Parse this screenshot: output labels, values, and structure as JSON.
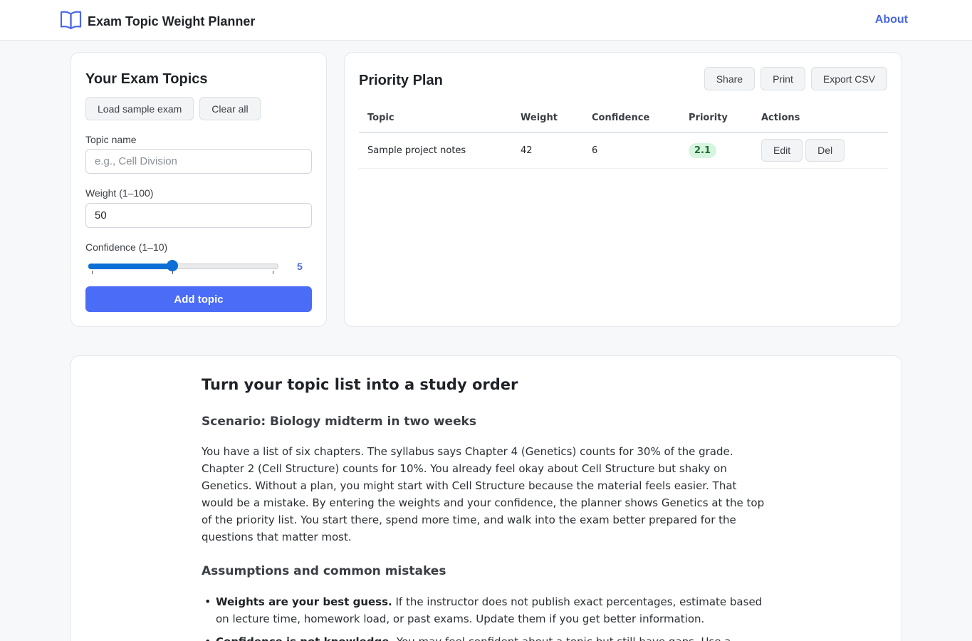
{
  "header": {
    "title": "Exam Topic Weight Planner",
    "about_label": "About",
    "logo_icon": "open-book-icon",
    "accent_color": "#4a67e6"
  },
  "topics_panel": {
    "title": "Your Exam Topics",
    "load_sample_label": "Load sample exam",
    "clear_all_label": "Clear all",
    "topic_name_label": "Topic name",
    "topic_name_placeholder": "e.g., Cell Division",
    "topic_name_value": "",
    "weight_label": "Weight (1–100)",
    "weight_value": "50",
    "confidence_label": "Confidence (1–10)",
    "confidence_value": "5",
    "confidence_min": 1,
    "confidence_max": 10,
    "add_topic_label": "Add topic"
  },
  "plan_panel": {
    "title": "Priority Plan",
    "share_label": "Share",
    "print_label": "Print",
    "export_label": "Export CSV",
    "columns": [
      "Topic",
      "Weight",
      "Confidence",
      "Priority",
      "Actions"
    ],
    "rows": [
      {
        "topic": "Sample project notes",
        "weight": "42",
        "confidence": "6",
        "priority": "2.1",
        "edit_label": "Edit",
        "delete_label": "Del"
      }
    ],
    "priority_badge_color": "#d6f5de"
  },
  "article": {
    "title": "Turn your topic list into a study order",
    "scenario_heading": "Scenario: Biology midterm in two weeks",
    "scenario_text": "You have a list of six chapters. The syllabus says Chapter 4 (Genetics) counts for 30% of the grade. Chapter 2 (Cell Structure) counts for 10%. You already feel okay about Cell Structure but shaky on Genetics. Without a plan, you might start with Cell Structure because the material feels easier. That would be a mistake. By entering the weights and your confidence, the planner shows Genetics at the top of the priority list. You start there, spend more time, and walk into the exam better prepared for the questions that matter most.",
    "assumptions_heading": "Assumptions and common mistakes",
    "bullets": [
      {
        "bold": "Weights are your best guess.",
        "text": " If the instructor does not publish exact percentages, estimate based on lecture time, homework load, or past exams. Update them if you get better information."
      },
      {
        "bold": "Confidence is not knowledge.",
        "text": " You may feel confident about a topic but still have gaps. Use a practice quiz to"
      }
    ]
  }
}
